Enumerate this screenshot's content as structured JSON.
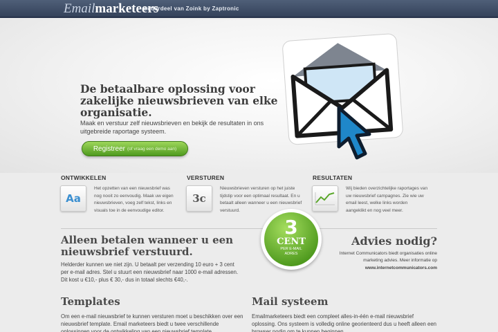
{
  "header": {
    "brand_part1": "Email",
    "brand_part2": "marketeers",
    "tagline": "onderdeel van Zoink by Zaptronic"
  },
  "hero": {
    "headline": "De betaalbare oplossing voor zakelijke nieuwsbrieven van elke organisatie.",
    "subline": "Maak en verstuur zelf nieuwsbrieven en bekijk de resultaten in ons uitgebreide raportage systeem.",
    "cta_label": "Registreer",
    "cta_sub": "(of vraag een demo aan)",
    "illustration_icon": "envelope-cursor-icon"
  },
  "features": [
    {
      "title": "ONTWIKKELEN",
      "icon_text": "Aa",
      "icon": "font-icon",
      "text": "Het opzetten van een nieuwsbrief was nog nooit zo eenvoudig. Maak uw eigen nieuwsbrieven, voeg zelf tekst, links en visuals toe in de eenvoudige editor."
    },
    {
      "title": "VERSTUREN",
      "icon_text": "3c",
      "icon": "price-icon",
      "text": "Nieuwsbrieven versturen op het juiste tijdstip voor een optimaal resultaat. En u betaalt alleen wanneer u een nieuwsbrief verstuurd."
    },
    {
      "title": "RESULTATEN",
      "icon_text": "",
      "icon": "chart-line-icon",
      "text": "Wij bieden overzichtelijke raportages van uw nieuwsbrief campagnes. Zie wie uw email leest, welke links worden aangeklikt en nog veel meer."
    }
  ],
  "pricing": {
    "title": "Alleen betalen wanneer u een nieuwsbrief verstuurd.",
    "text": "Helderder kunnen we niet zijn. U betaalt per verzending 10 euro + 3 cent per e-mail adres. Stel u stuurt een nieuwsbrief naar 1000 e-mail adressen. Dit kost u €10,- plus € 30,- dus in totaal slechts €40,-."
  },
  "badge": {
    "number": "3",
    "unit": "CENT",
    "small_line1": "PER E-MAIL",
    "small_line2": "ADRES"
  },
  "advice": {
    "title": "Advies nodig?",
    "text": "Internet Communicators biedt organisaties online marketing advies. Meer informatie op",
    "link": "www.internetcommunicators.com"
  },
  "templates": {
    "title": "Templates",
    "text": "Om een e-mail nieuwsbrief te kunnen versturen moet u beschikken over een nieuwsbrief template. Email marketeers biedt u twee verschillende oplossingen voor de ontwikkeling van een nieuwsbrief template."
  },
  "mailsystem": {
    "title": "Mail systeem",
    "text": "Emailmarketeers biedt een compleet alles-in-één e-mail nieuwsbrief oplossing. Ons systeem is volledig online georienteerd dus u heeft alleen een browser nodig om te kunnen beginnen."
  },
  "colors": {
    "header_bg": "#3d4b64",
    "accent_green": "#5aa72a",
    "envelope_blue": "#8fc4ea",
    "cursor_blue": "#1f87c9"
  }
}
